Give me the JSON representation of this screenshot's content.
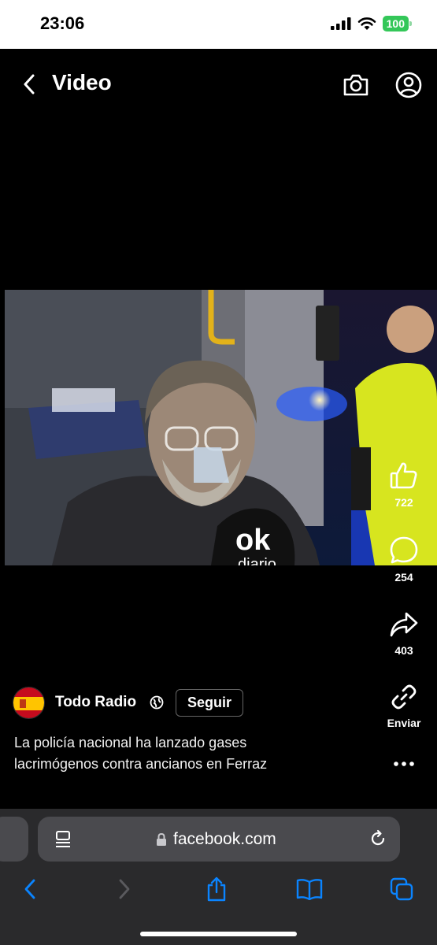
{
  "status_bar": {
    "time": "23:06",
    "battery": "100"
  },
  "header": {
    "title": "Video",
    "back_icon": "chevron-left-icon",
    "camera_icon": "camera-icon",
    "profile_icon": "profile-icon"
  },
  "video": {
    "watermark": "ok",
    "watermark_sub": "diario"
  },
  "actions": {
    "likes": "722",
    "comments": "254",
    "shares": "403",
    "send_label": "Enviar"
  },
  "post": {
    "author": "Todo Radio",
    "follow_label": "Seguir",
    "caption_line1": "La policía nacional ha lanzado gases",
    "caption_line2": "lacrimógenos contra ancianos en Ferraz"
  },
  "browser": {
    "url": "facebook.com"
  },
  "colors": {
    "accent_blue": "#0a84ff",
    "battery_green": "#34c759",
    "background": "#000000"
  }
}
